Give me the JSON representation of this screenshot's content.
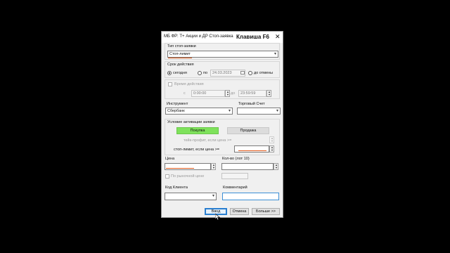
{
  "window": {
    "title": "МБ ФР: Т+ Акции и ДР Стоп-заявка",
    "hotkey_label": "Клавиша F6",
    "close_glyph": "✕"
  },
  "stop_type": {
    "label": "Тип стоп-заявки",
    "value": "Стоп-лимит"
  },
  "validity": {
    "label": "Срок действия",
    "today": "сегодня",
    "until": "по",
    "until_date": "24.03.2023",
    "until_cancel": "до отмены",
    "selected": "сегодня"
  },
  "action_time": {
    "label": "Время действия",
    "from": "с",
    "from_value": "0:00:00",
    "to": "до",
    "to_value": "23:59:59"
  },
  "instrument": {
    "label": "Инструмент",
    "value": "Сбербанк"
  },
  "account": {
    "label": "Торговый Счет",
    "value": ""
  },
  "activation": {
    "label": "Условие активации заявки",
    "buy": "Покупка",
    "sell": "Продажа",
    "take_profit": "тейк-профит, если цена >=",
    "stop_limit": "стоп-лимит, если цена >=",
    "stop_limit_value": ""
  },
  "price": {
    "label": "Цена",
    "value": "",
    "market_label": "По рыночной цене"
  },
  "quantity": {
    "label": "Кол-во (лот 10)",
    "value": ""
  },
  "client_code": {
    "label": "Код Клиента",
    "value": ""
  },
  "comment": {
    "label": "Комментарий",
    "value": ""
  },
  "buttons": {
    "ok": "Ввод",
    "cancel": "Отмена",
    "more": "Больше >>"
  },
  "colors": {
    "buy": "#7fe25c",
    "highlight_underline": "#e05a1c",
    "ok_border": "#2a7fd0"
  },
  "icons": {
    "dropdown": "▾",
    "spin_up": "▲",
    "spin_down": "▼"
  }
}
